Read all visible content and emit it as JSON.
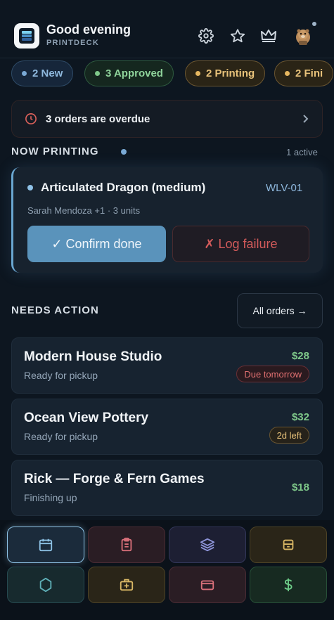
{
  "header": {
    "greeting": "Good evening",
    "brand": "PRINTDECK",
    "icons": [
      "settings-gear-icon",
      "star-icon",
      "crown-icon",
      "user-avatar"
    ]
  },
  "chips": [
    {
      "label": "2 New",
      "color": "#7aa9d4"
    },
    {
      "label": "3 Approved",
      "color": "#7fc98a"
    },
    {
      "label": "2 Printing",
      "color": "#e6b760"
    },
    {
      "label": "2 Fini",
      "color": "#e6b760"
    }
  ],
  "overdue": {
    "text": "3 orders are overdue",
    "icon": "clock-icon"
  },
  "now_printing": {
    "title": "NOW PRINTING",
    "active_count": "1 active",
    "job": {
      "name": "Articulated Dragon (medium)",
      "code": "WLV-01",
      "meta": "Sarah Mendoza +1 · 3 units"
    },
    "confirm_label": "✓ Confirm done",
    "fail_label": "✗ Log failure"
  },
  "needs_action": {
    "title": "NEEDS ACTION",
    "all_orders_label": "All orders →"
  },
  "orders": [
    {
      "name": "Modern House Studio",
      "status": "Ready for pickup",
      "price": "$28",
      "badge": "Due tomorrow",
      "badge_kind": "danger"
    },
    {
      "name": "Ocean View Pottery",
      "status": "Ready for pickup",
      "price": "$32",
      "badge": "2d left",
      "badge_kind": "warn"
    },
    {
      "name": "Rick — Forge & Fern Games",
      "status": "Finishing up",
      "price": "$18",
      "badge": "",
      "badge_kind": "none"
    }
  ],
  "bottom_nav": [
    {
      "icon": "calendar-icon",
      "color": "#8ec3e6"
    },
    {
      "icon": "clipboard-icon",
      "color": "#d9707a"
    },
    {
      "icon": "layers-icon",
      "color": "#8d94d8"
    },
    {
      "icon": "archive-box-icon",
      "color": "#d9b765"
    },
    {
      "icon": "hexagon-icon",
      "color": "#5fb0b8"
    },
    {
      "icon": "medical-kit-icon",
      "color": "#d9b765"
    },
    {
      "icon": "credit-card-icon",
      "color": "#d9707a"
    },
    {
      "icon": "dollar-icon",
      "color": "#6fcf8a"
    }
  ]
}
